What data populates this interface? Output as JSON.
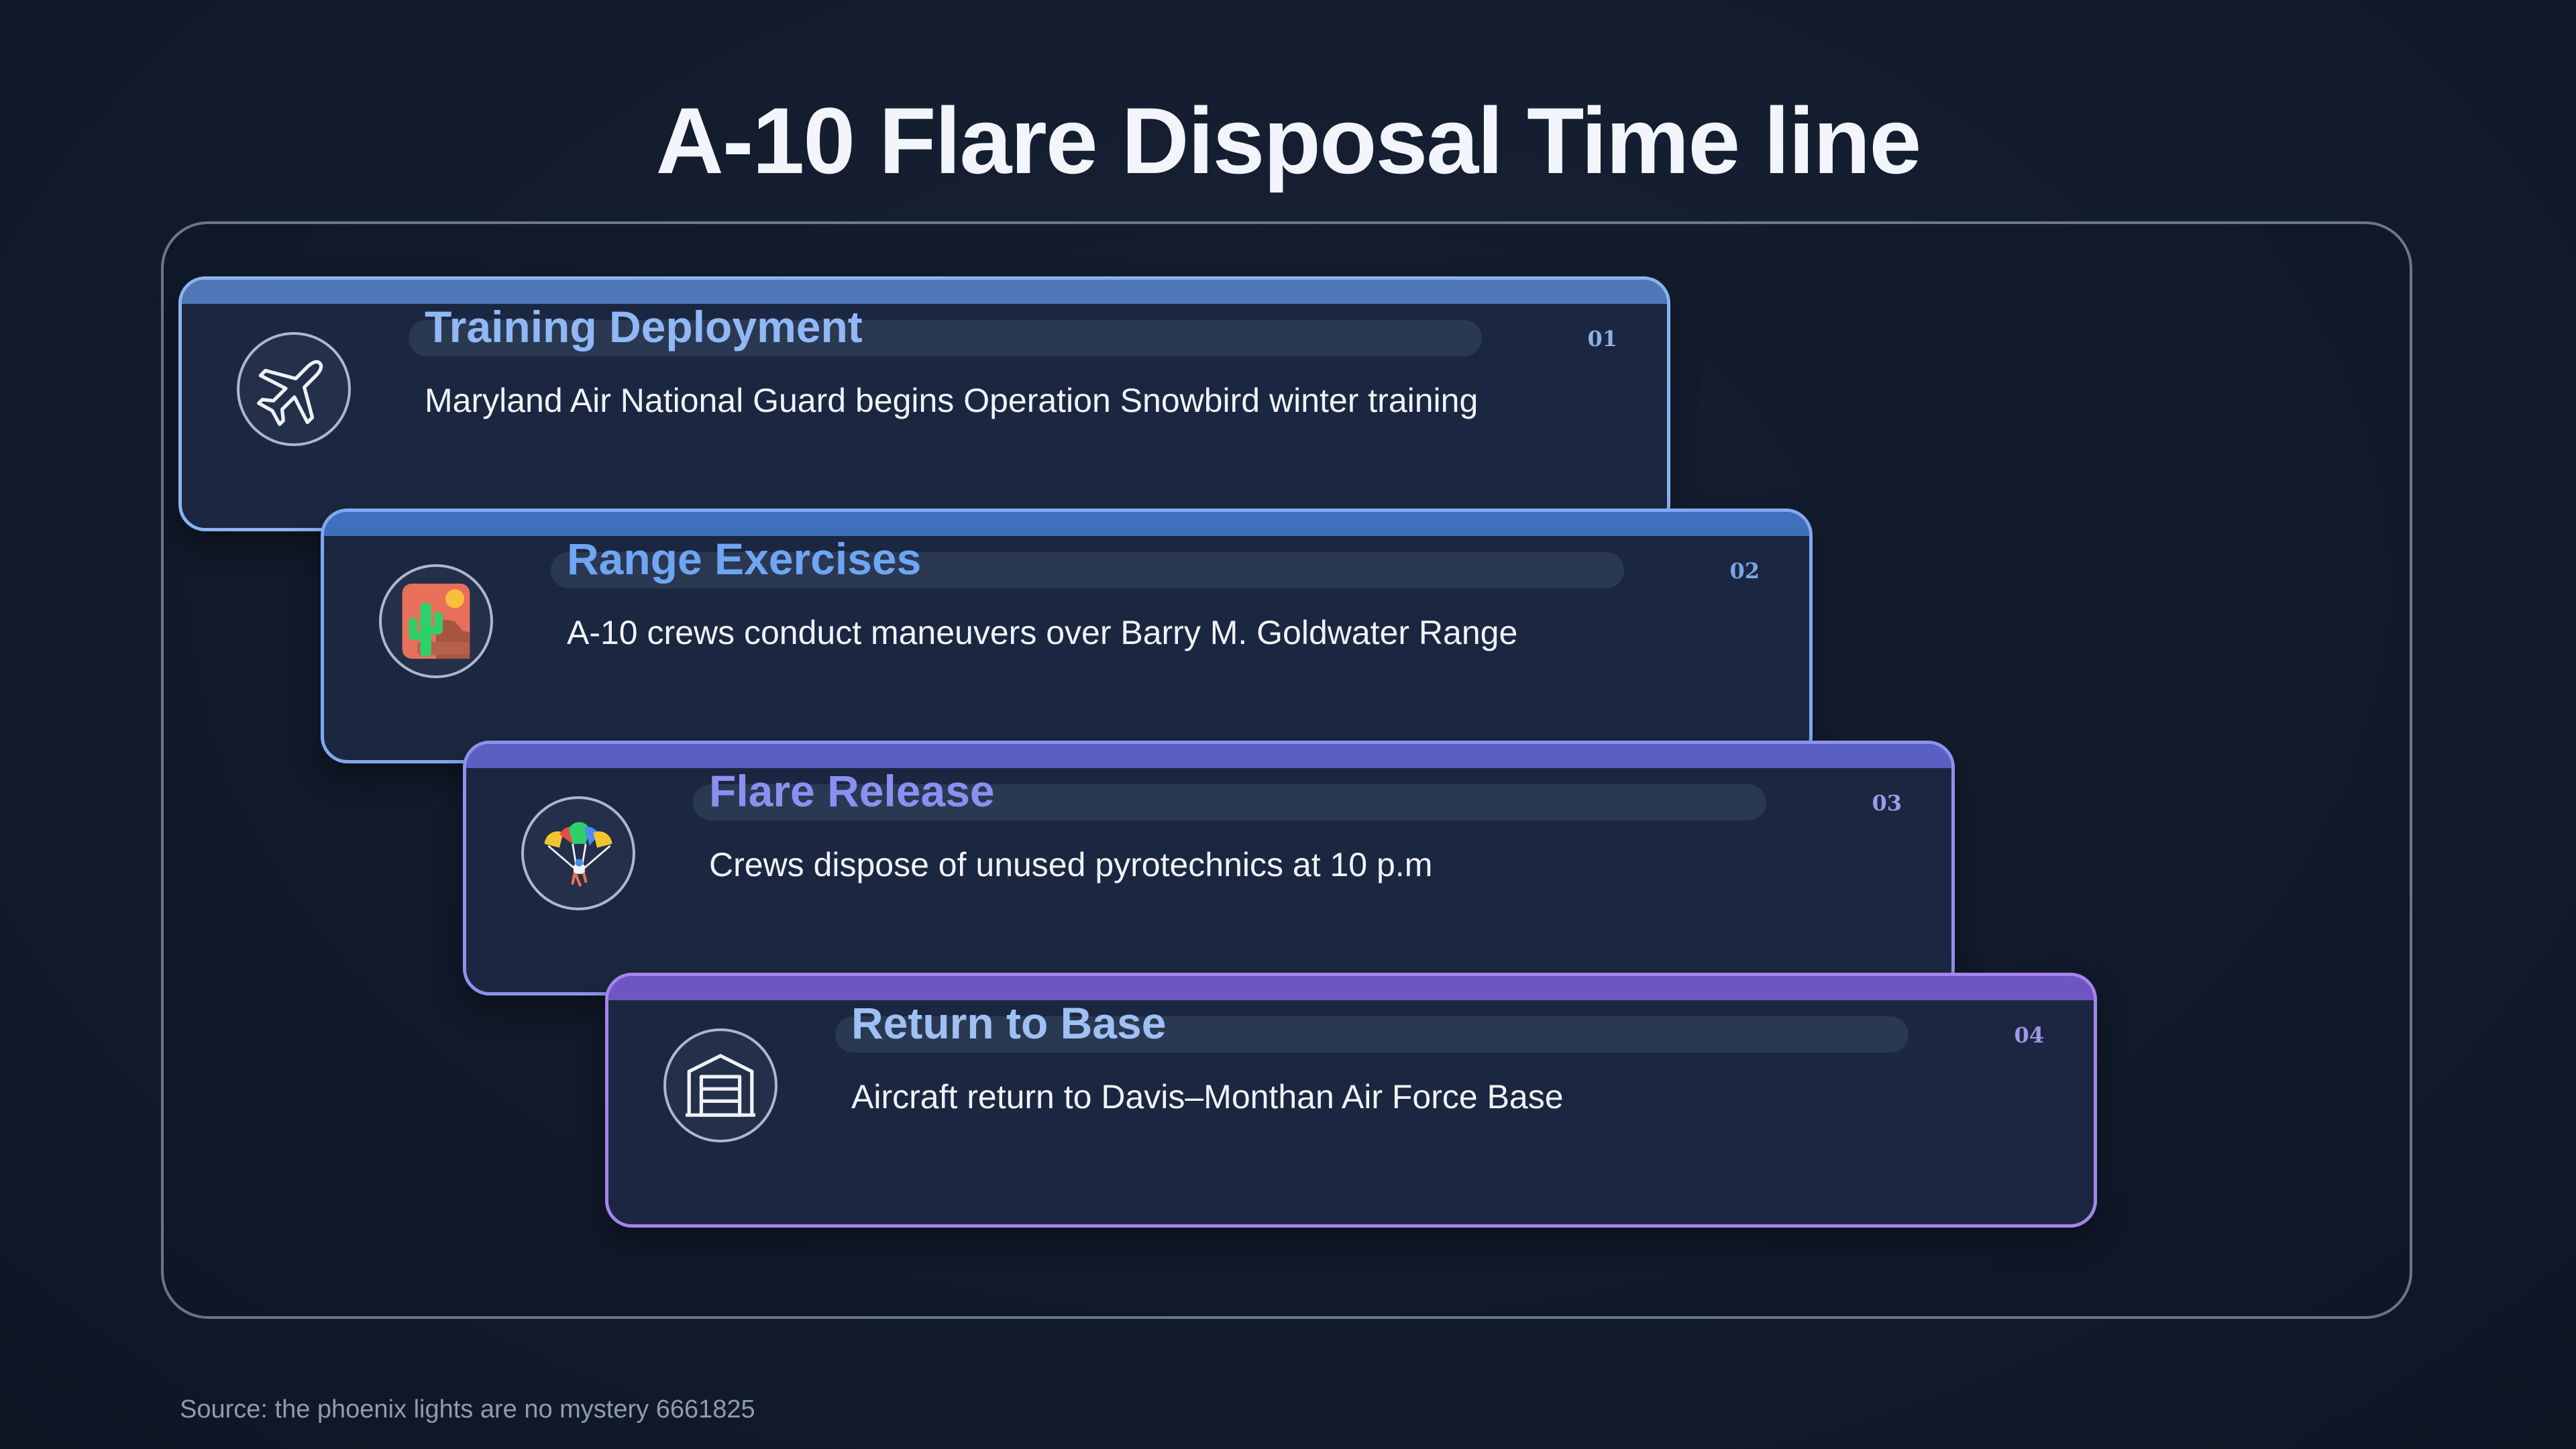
{
  "title": "A-10 Flare Disposal Time line",
  "steps": [
    {
      "number": "01",
      "heading": "Training Deployment",
      "description": "Maryland Air National Guard begins Operation Snowbird winter training",
      "icon": "airplane-icon"
    },
    {
      "number": "02",
      "heading": "Range Exercises",
      "description": "A-10 crews conduct maneuvers over Barry M. Goldwater Range",
      "icon": "desert-cactus-icon"
    },
    {
      "number": "03",
      "heading": "Flare Release",
      "description": "Crews dispose of unused pyrotechnics at 10 p.m",
      "icon": "parachute-icon"
    },
    {
      "number": "04",
      "heading": "Return to Base",
      "description": "Aircraft return to Davis–Monthan Air Force Base",
      "icon": "hangar-icon"
    }
  ],
  "source": "Source: the phoenix lights are no mystery 6661825",
  "colors": {
    "background": "#131c2d",
    "card": "#1b2740",
    "accent_blue": "#7eaaf0",
    "accent_purple": "#a585ec"
  }
}
